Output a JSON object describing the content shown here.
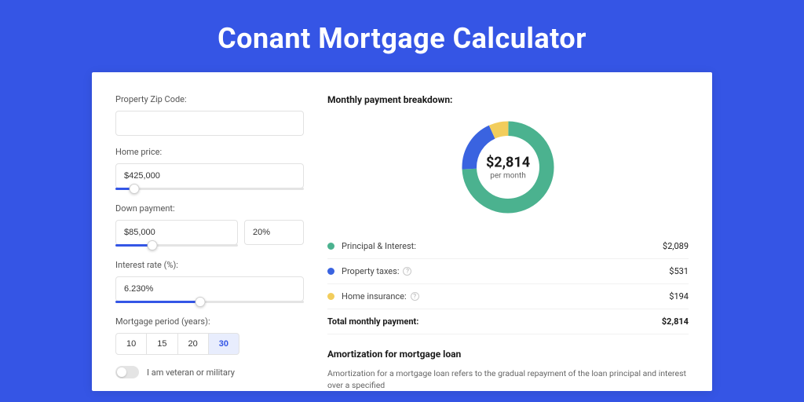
{
  "page_title": "Conant Mortgage Calculator",
  "fields": {
    "zip": {
      "label": "Property Zip Code:",
      "value": ""
    },
    "price": {
      "label": "Home price:",
      "value": "$425,000",
      "slider_pct": 10
    },
    "down": {
      "label": "Down payment:",
      "value": "$85,000",
      "pct_value": "20%",
      "slider_pct": 30
    },
    "rate": {
      "label": "Interest rate (%):",
      "value": "6.230%",
      "slider_pct": 45
    },
    "period": {
      "label": "Mortgage period (years):",
      "options": [
        "10",
        "15",
        "20",
        "30"
      ],
      "selected": "30"
    },
    "veteran": {
      "label": "I am veteran or military",
      "on": false
    }
  },
  "breakdown": {
    "heading": "Monthly payment breakdown:",
    "center_amount": "$2,814",
    "center_sub": "per month",
    "items": [
      {
        "label": "Principal & Interest:",
        "value": "$2,089",
        "color": "#4bb28f",
        "has_info": false
      },
      {
        "label": "Property taxes:",
        "value": "$531",
        "color": "#3a63e0",
        "has_info": true
      },
      {
        "label": "Home insurance:",
        "value": "$194",
        "color": "#f2cd5c",
        "has_info": true
      }
    ],
    "total": {
      "label": "Total monthly payment:",
      "value": "$2,814"
    }
  },
  "amortization": {
    "heading": "Amortization for mortgage loan",
    "text": "Amortization for a mortgage loan refers to the gradual repayment of the loan principal and interest over a specified"
  },
  "chart_data": {
    "type": "pie",
    "title": "Monthly payment breakdown",
    "series": [
      {
        "name": "Principal & Interest",
        "value": 2089,
        "color": "#4bb28f"
      },
      {
        "name": "Property taxes",
        "value": 531,
        "color": "#3a63e0"
      },
      {
        "name": "Home insurance",
        "value": 194,
        "color": "#f2cd5c"
      }
    ],
    "total": 2814,
    "unit": "USD/month"
  }
}
